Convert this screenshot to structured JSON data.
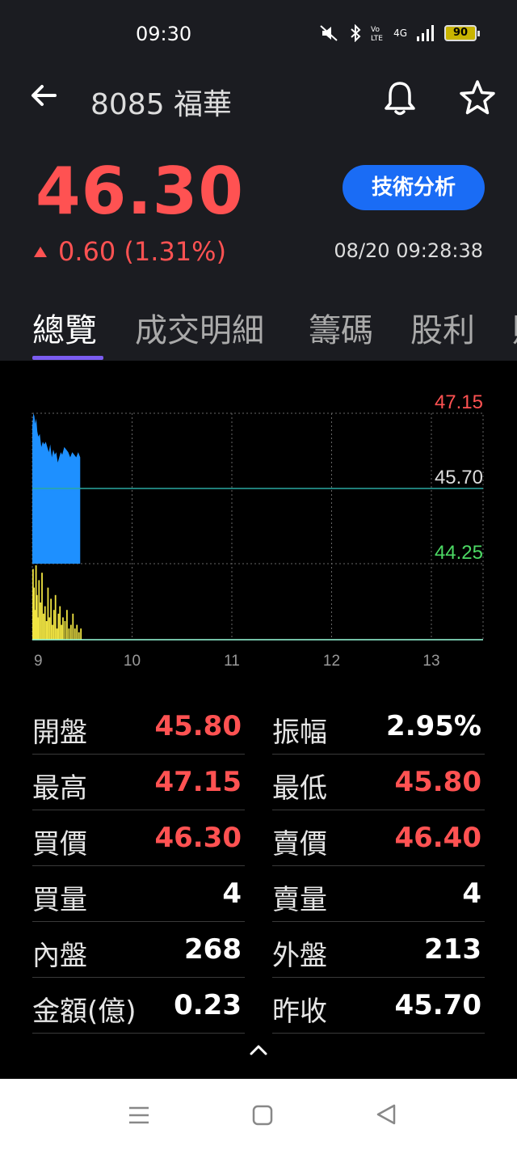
{
  "status": {
    "time": "09:30",
    "battery": "90",
    "network": "4G"
  },
  "header": {
    "title": "8085 福華",
    "tech_button": "技術分析"
  },
  "quote": {
    "price": "46.30",
    "change": "0.60 (1.31%)",
    "timestamp": "08/20 09:28:38"
  },
  "tabs": [
    "總覽",
    "成交明細",
    "籌碼",
    "股利",
    "財"
  ],
  "colors": {
    "up": "#ff5252",
    "down": "#4cd964",
    "accent": "#1a6cf5",
    "tab_indicator": "#7b5cf0",
    "price_area": "#1e90ff",
    "volume": "#f0e442"
  },
  "chart_data": {
    "type": "area",
    "y_high": 47.15,
    "y_ref": 45.7,
    "y_low": 44.25,
    "y_high_label": "47.15",
    "y_ref_label": "45.70",
    "y_low_label": "44.25",
    "x_ticks": [
      "9",
      "10",
      "11",
      "12",
      "13"
    ],
    "x_range_hours": [
      9,
      13.5
    ],
    "price_series": [
      [
        9.0,
        46.9
      ],
      [
        9.01,
        47.15
      ],
      [
        9.02,
        47.1
      ],
      [
        9.03,
        46.95
      ],
      [
        9.04,
        47.05
      ],
      [
        9.05,
        46.8
      ],
      [
        9.06,
        46.7
      ],
      [
        9.075,
        46.75
      ],
      [
        9.09,
        46.5
      ],
      [
        9.105,
        46.6
      ],
      [
        9.12,
        46.55
      ],
      [
        9.135,
        46.6
      ],
      [
        9.15,
        46.5
      ],
      [
        9.165,
        46.4
      ],
      [
        9.18,
        46.55
      ],
      [
        9.195,
        46.3
      ],
      [
        9.21,
        46.45
      ],
      [
        9.225,
        46.35
      ],
      [
        9.24,
        46.4
      ],
      [
        9.255,
        46.2
      ],
      [
        9.27,
        46.3
      ],
      [
        9.285,
        46.4
      ],
      [
        9.3,
        46.35
      ],
      [
        9.32,
        46.5
      ],
      [
        9.34,
        46.45
      ],
      [
        9.36,
        46.4
      ],
      [
        9.38,
        46.3
      ],
      [
        9.4,
        46.4
      ],
      [
        9.42,
        46.35
      ],
      [
        9.44,
        46.3
      ],
      [
        9.46,
        46.4
      ],
      [
        9.48,
        46.3
      ]
    ],
    "volume_series": [
      [
        9.0,
        95
      ],
      [
        9.01,
        70
      ],
      [
        9.02,
        40
      ],
      [
        9.03,
        100
      ],
      [
        9.04,
        60
      ],
      [
        9.05,
        30
      ],
      [
        9.06,
        80
      ],
      [
        9.075,
        50
      ],
      [
        9.09,
        90
      ],
      [
        9.105,
        35
      ],
      [
        9.12,
        45
      ],
      [
        9.135,
        25
      ],
      [
        9.15,
        70
      ],
      [
        9.165,
        30
      ],
      [
        9.18,
        55
      ],
      [
        9.195,
        20
      ],
      [
        9.21,
        40
      ],
      [
        9.225,
        60
      ],
      [
        9.24,
        15
      ],
      [
        9.255,
        35
      ],
      [
        9.27,
        45
      ],
      [
        9.285,
        20
      ],
      [
        9.3,
        30
      ],
      [
        9.32,
        25
      ],
      [
        9.34,
        40
      ],
      [
        9.36,
        15
      ],
      [
        9.38,
        20
      ],
      [
        9.4,
        35
      ],
      [
        9.42,
        15
      ],
      [
        9.44,
        20
      ],
      [
        9.46,
        10
      ],
      [
        9.48,
        15
      ]
    ]
  },
  "stats": [
    {
      "l_label": "開盤",
      "l_value": "45.80",
      "l_color": "red",
      "r_label": "振幅",
      "r_value": "2.95%",
      "r_color": "white"
    },
    {
      "l_label": "最高",
      "l_value": "47.15",
      "l_color": "red",
      "r_label": "最低",
      "r_value": "45.80",
      "r_color": "red"
    },
    {
      "l_label": "買價",
      "l_value": "46.30",
      "l_color": "red",
      "r_label": "賣價",
      "r_value": "46.40",
      "r_color": "red"
    },
    {
      "l_label": "買量",
      "l_value": "4",
      "l_color": "white",
      "r_label": "賣量",
      "r_value": "4",
      "r_color": "white"
    },
    {
      "l_label": "內盤",
      "l_value": "268",
      "l_color": "white",
      "r_label": "外盤",
      "r_value": "213",
      "r_color": "white"
    },
    {
      "l_label": "金額(億)",
      "l_value": "0.23",
      "l_color": "white",
      "r_label": "昨收",
      "r_value": "45.70",
      "r_color": "white"
    }
  ],
  "icons": {
    "back": "arrow-left-icon",
    "alert": "bell-icon",
    "favorite": "star-icon",
    "collapse": "chevron-up-icon"
  }
}
